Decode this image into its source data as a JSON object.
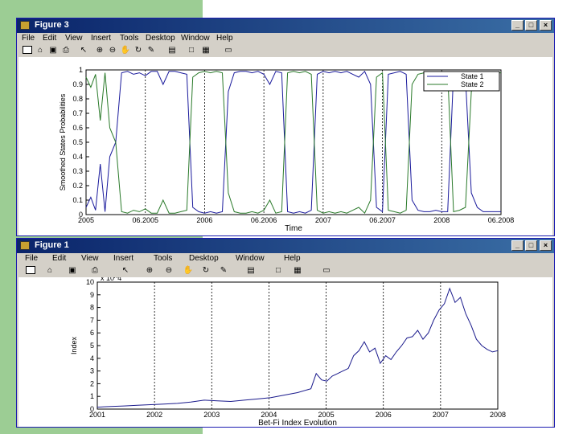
{
  "figure3": {
    "title": "Figure 3",
    "menus": [
      "File",
      "Edit",
      "View",
      "Insert",
      "Tools",
      "Desktop",
      "Window",
      "Help"
    ],
    "toolbar_icons": [
      "new-icon",
      "open-icon",
      "save-icon",
      "print-icon",
      "pointer-icon",
      "zoom-in-icon",
      "zoom-out-icon",
      "pan-icon",
      "rotate-icon",
      "data-cursor-icon",
      "colorbar-icon",
      "legend-icon",
      "hide-tools-icon",
      "show-tools-icon"
    ],
    "window_buttons": [
      "_",
      "□",
      "×"
    ]
  },
  "figure1": {
    "title": "Figure 1",
    "menus": [
      "File",
      "Edit",
      "View",
      "Insert",
      "Tools",
      "Desktop",
      "Window",
      "Help"
    ],
    "toolbar_icons": [
      "new-icon",
      "open-icon",
      "save-icon",
      "print-icon",
      "pointer-icon",
      "zoom-in-icon",
      "zoom-out-icon",
      "pan-icon",
      "rotate-icon",
      "data-cursor-icon",
      "colorbar-icon",
      "legend-icon",
      "hide-tools-icon",
      "show-tools-icon"
    ],
    "window_buttons": [
      "_",
      "□",
      "×"
    ]
  },
  "chart_data": [
    {
      "type": "line",
      "title": "",
      "xlabel": "Time",
      "ylabel": "Smoothed States Probabilities",
      "ylim": [
        0,
        1
      ],
      "yticks": [
        "0",
        "0.1",
        "0.2",
        "0.3",
        "0.4",
        "0.5",
        "0.6",
        "0.7",
        "0.8",
        "0.9",
        "1"
      ],
      "xticks": [
        "2005",
        "06.2005",
        "2006",
        "06.2006",
        "2007",
        "06.2007",
        "2008",
        "06.2008"
      ],
      "xlim": [
        2005.0,
        2008.5
      ],
      "legend_position": "top-right",
      "grid_x_dotted": true,
      "colors": {
        "state1": "#1a1a9c",
        "state2": "#2a7a2a"
      },
      "series": [
        {
          "name": "State 1",
          "x": [
            2005.0,
            2005.04,
            2005.08,
            2005.12,
            2005.16,
            2005.2,
            2005.25,
            2005.3,
            2005.35,
            2005.4,
            2005.45,
            2005.5,
            2005.55,
            2005.6,
            2005.65,
            2005.7,
            2005.75,
            2005.8,
            2005.85,
            2005.9,
            2005.95,
            2006.0,
            2006.05,
            2006.1,
            2006.15,
            2006.2,
            2006.25,
            2006.3,
            2006.35,
            2006.4,
            2006.45,
            2006.5,
            2006.55,
            2006.6,
            2006.65,
            2006.7,
            2006.75,
            2006.8,
            2006.85,
            2006.9,
            2006.95,
            2007.0,
            2007.05,
            2007.1,
            2007.15,
            2007.2,
            2007.25,
            2007.3,
            2007.35,
            2007.4,
            2007.45,
            2007.5,
            2007.55,
            2007.6,
            2007.65,
            2007.7,
            2007.75,
            2007.8,
            2007.85,
            2007.9,
            2007.95,
            2008.0,
            2008.05,
            2008.1,
            2008.15,
            2008.2,
            2008.25,
            2008.3,
            2008.35,
            2008.4,
            2008.45,
            2008.5
          ],
          "values": [
            0.05,
            0.12,
            0.03,
            0.35,
            0.02,
            0.4,
            0.5,
            0.98,
            0.99,
            0.97,
            0.98,
            0.96,
            0.99,
            0.99,
            0.9,
            0.99,
            0.99,
            0.98,
            0.97,
            0.05,
            0.02,
            0.01,
            0.02,
            0.01,
            0.02,
            0.85,
            0.98,
            0.99,
            0.99,
            0.98,
            0.99,
            0.97,
            0.9,
            0.99,
            0.98,
            0.02,
            0.01,
            0.02,
            0.01,
            0.03,
            0.97,
            0.99,
            0.98,
            0.99,
            0.98,
            0.99,
            0.97,
            0.95,
            0.99,
            0.9,
            0.05,
            0.02,
            0.97,
            0.98,
            0.99,
            0.97,
            0.1,
            0.03,
            0.02,
            0.02,
            0.03,
            0.02,
            0.02,
            0.98,
            0.97,
            0.95,
            0.15,
            0.05,
            0.02,
            0.02,
            0.02,
            0.02
          ]
        },
        {
          "name": "State 2",
          "x": [
            2005.0,
            2005.04,
            2005.08,
            2005.12,
            2005.16,
            2005.2,
            2005.25,
            2005.3,
            2005.35,
            2005.4,
            2005.45,
            2005.5,
            2005.55,
            2005.6,
            2005.65,
            2005.7,
            2005.75,
            2005.8,
            2005.85,
            2005.9,
            2005.95,
            2006.0,
            2006.05,
            2006.1,
            2006.15,
            2006.2,
            2006.25,
            2006.3,
            2006.35,
            2006.4,
            2006.45,
            2006.5,
            2006.55,
            2006.6,
            2006.65,
            2006.7,
            2006.75,
            2006.8,
            2006.85,
            2006.9,
            2006.95,
            2007.0,
            2007.05,
            2007.1,
            2007.15,
            2007.2,
            2007.25,
            2007.3,
            2007.35,
            2007.4,
            2007.45,
            2007.5,
            2007.55,
            2007.6,
            2007.65,
            2007.7,
            2007.75,
            2007.8,
            2007.85,
            2007.9,
            2007.95,
            2008.0,
            2008.05,
            2008.1,
            2008.15,
            2008.2,
            2008.25,
            2008.3,
            2008.35,
            2008.4,
            2008.45,
            2008.5
          ],
          "values": [
            0.95,
            0.88,
            0.97,
            0.65,
            0.98,
            0.6,
            0.5,
            0.02,
            0.01,
            0.03,
            0.02,
            0.04,
            0.01,
            0.01,
            0.1,
            0.01,
            0.01,
            0.02,
            0.03,
            0.95,
            0.98,
            0.99,
            0.98,
            0.99,
            0.98,
            0.15,
            0.02,
            0.01,
            0.01,
            0.02,
            0.01,
            0.03,
            0.1,
            0.01,
            0.02,
            0.98,
            0.99,
            0.98,
            0.99,
            0.97,
            0.03,
            0.01,
            0.02,
            0.01,
            0.02,
            0.01,
            0.03,
            0.05,
            0.01,
            0.1,
            0.95,
            0.98,
            0.03,
            0.02,
            0.01,
            0.03,
            0.9,
            0.97,
            0.98,
            0.98,
            0.97,
            0.98,
            0.98,
            0.02,
            0.03,
            0.05,
            0.85,
            0.95,
            0.98,
            0.98,
            0.98,
            0.98
          ]
        }
      ]
    },
    {
      "type": "line",
      "title": "",
      "xlabel": "Bet-Fi Index Evolution",
      "ylabel": "Index",
      "ylim": [
        0,
        10
      ],
      "y_multiplier": "x 10^4",
      "yticks": [
        "0",
        "1",
        "2",
        "3",
        "4",
        "5",
        "6",
        "7",
        "8",
        "9",
        "10"
      ],
      "xticks": [
        "2001",
        "2002",
        "2003",
        "2004",
        "2005",
        "2006",
        "2007",
        "2008"
      ],
      "xlim": [
        2001,
        2008.5
      ],
      "grid_x_dotted": true,
      "colors": {
        "line": "#1a1a8c"
      },
      "series": [
        {
          "name": "",
          "x": [
            2001.0,
            2001.25,
            2001.5,
            2001.75,
            2002.0,
            2002.25,
            2002.5,
            2002.75,
            2003.0,
            2003.25,
            2003.5,
            2003.75,
            2004.0,
            2004.25,
            2004.5,
            2004.75,
            2005.0,
            2005.1,
            2005.2,
            2005.3,
            2005.4,
            2005.5,
            2005.6,
            2005.7,
            2005.8,
            2005.9,
            2006.0,
            2006.1,
            2006.2,
            2006.3,
            2006.4,
            2006.5,
            2006.6,
            2006.7,
            2006.8,
            2006.9,
            2007.0,
            2007.1,
            2007.2,
            2007.3,
            2007.4,
            2007.5,
            2007.6,
            2007.7,
            2007.8,
            2007.9,
            2008.0,
            2008.1,
            2008.2,
            2008.3,
            2008.4,
            2008.5
          ],
          "values": [
            0.15,
            0.2,
            0.25,
            0.3,
            0.35,
            0.4,
            0.45,
            0.55,
            0.7,
            0.65,
            0.6,
            0.7,
            0.8,
            0.9,
            1.1,
            1.3,
            1.6,
            2.8,
            2.3,
            2.2,
            2.6,
            2.8,
            3.0,
            3.2,
            4.2,
            4.6,
            5.3,
            4.5,
            4.8,
            3.6,
            4.2,
            3.9,
            4.5,
            5.0,
            5.6,
            5.7,
            6.2,
            5.5,
            6.0,
            7.0,
            7.8,
            8.3,
            9.5,
            8.4,
            8.8,
            7.5,
            6.6,
            5.5,
            5.0,
            4.7,
            4.5,
            4.6
          ]
        }
      ]
    }
  ]
}
